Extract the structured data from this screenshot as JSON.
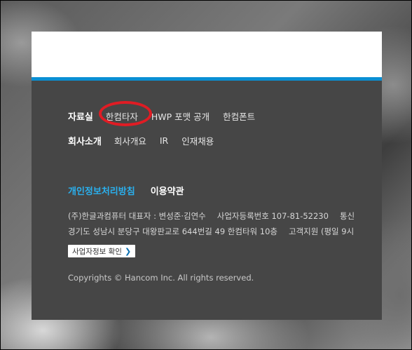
{
  "nav": {
    "resources": {
      "title": "자료실",
      "links": [
        "한컴타자",
        "HWP 포맷 공개",
        "한컴폰트"
      ]
    },
    "company": {
      "title": "회사소개",
      "links": [
        "회사개요",
        "IR",
        "인재채용"
      ]
    }
  },
  "policy": {
    "privacy": "개인정보처리방침",
    "terms": "이용약관"
  },
  "info": {
    "line1_company": "(주)한글과컴퓨터 대표자 : 변성준·김연수",
    "line1_registration": "사업자등록번호 107-81-52230",
    "line1_more": "통신",
    "line2_address": "경기도 성남시 분당구 대왕판교로 644번길 49 한컴타워 10층",
    "line2_support": "고객지원 (평일 9시"
  },
  "biz_button": {
    "label": "사업자정보 확인",
    "chevron": "❯"
  },
  "copyright": "Copyrights © Hancom Inc. All rights reserved.",
  "colors": {
    "accent": "#0a8fd3",
    "privacy_link": "#2ab0ee",
    "panel_bg": "#464646",
    "highlight_circle": "#e01c24"
  }
}
